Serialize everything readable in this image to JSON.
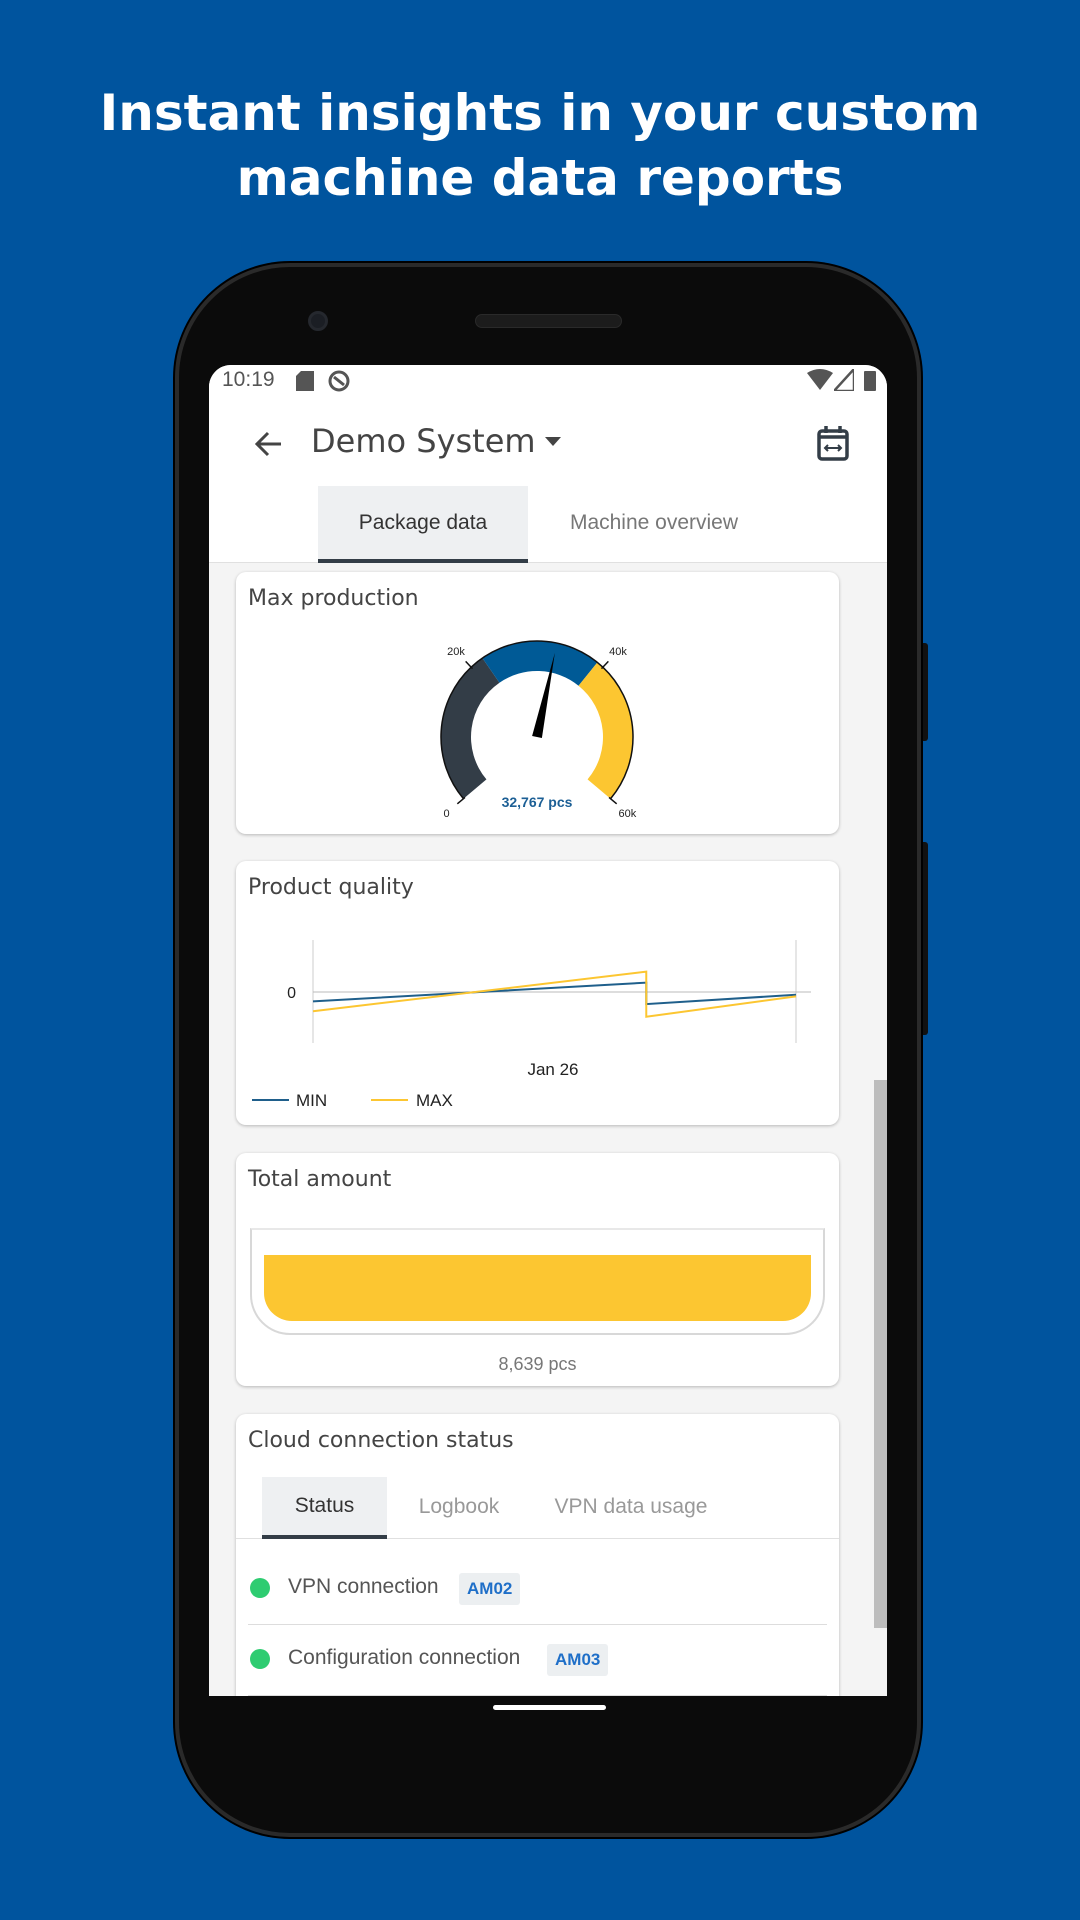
{
  "headline": {
    "line1": "Instant insights in your custom",
    "line2": "machine data reports"
  },
  "status_bar": {
    "time": "10:19",
    "icons": [
      "sd-card-icon",
      "sync-icon",
      "wifi-icon",
      "signal-icon",
      "battery-icon"
    ]
  },
  "app_bar": {
    "title": "Demo System",
    "back_icon": "arrow-left-icon",
    "dropdown_icon": "caret-down-icon",
    "calendar_icon": "calendar-range-icon"
  },
  "tabs": [
    {
      "label": "Package data",
      "active": true
    },
    {
      "label": "Machine overview",
      "active": false
    }
  ],
  "colors": {
    "brand": "#00549e",
    "dark": "#333d47",
    "blue": "#005a96",
    "yellow": "#fcc631",
    "green": "#2ecc71"
  },
  "max_production": {
    "title": "Max production",
    "value": 32767,
    "value_label": "32,767 pcs",
    "min": 0,
    "max": 60000,
    "ticks": [
      "0",
      "20k",
      "40k",
      "60k"
    ],
    "bands": [
      {
        "from": 0,
        "to": 22000,
        "color": "#333d47"
      },
      {
        "from": 22000,
        "to": 39000,
        "color": "#005a96"
      },
      {
        "from": 39000,
        "to": 60000,
        "color": "#fcc631"
      }
    ]
  },
  "chart_data": {
    "type": "line",
    "title": "Product quality",
    "xlabel": "",
    "ylabel": "",
    "x_tick_labels": [
      "Jan 26"
    ],
    "y_tick_labels": [
      "0"
    ],
    "ylim": [
      -1,
      1
    ],
    "grid": false,
    "legend": "bottom-left",
    "series": [
      {
        "name": "MIN",
        "color": "#1f5f8b",
        "points": [
          [
            0,
            -0.17
          ],
          [
            0.69,
            0.17
          ],
          [
            0.69,
            -0.22
          ],
          [
            1,
            -0.05
          ]
        ]
      },
      {
        "name": "MAX",
        "color": "#fcc631",
        "points": [
          [
            0,
            -0.35
          ],
          [
            0.69,
            0.37
          ],
          [
            0.69,
            -0.45
          ],
          [
            1,
            -0.08
          ]
        ]
      }
    ]
  },
  "total_amount": {
    "title": "Total amount",
    "value_label": "8,639 pcs",
    "fill_fraction": 1.0
  },
  "cloud": {
    "title": "Cloud connection status",
    "tabs": [
      {
        "label": "Status",
        "active": true
      },
      {
        "label": "Logbook"
      },
      {
        "label": "VPN data usage"
      }
    ],
    "rows": [
      {
        "label": "VPN connection",
        "badge": "AM02",
        "status": "connected"
      },
      {
        "label": "Configuration connection",
        "badge": "AM03",
        "status": "connected"
      }
    ]
  }
}
